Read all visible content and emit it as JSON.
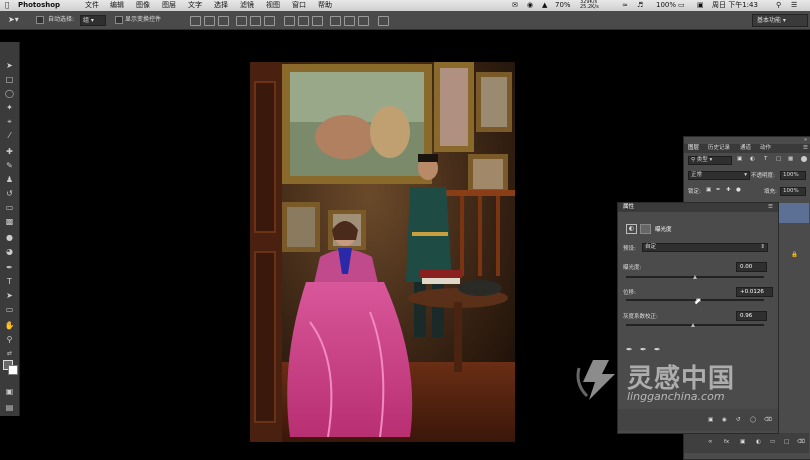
{
  "menubar": {
    "app_name": "Photoshop",
    "items": [
      "文件",
      "编辑",
      "图像",
      "图层",
      "文字",
      "选择",
      "滤镜",
      "视图",
      "窗口",
      "帮助"
    ],
    "battery_pct": "70%",
    "net_up": "329K/s",
    "net_down": "25.2K/s",
    "battery_full": "100%",
    "clock": "周日 下午1:43"
  },
  "options_bar": {
    "auto_select_label": "自动选择:",
    "auto_select_value": "组",
    "show_transform_label": "显示变换控件",
    "workspace": "基本功能"
  },
  "layers_panel": {
    "tabs": [
      "图层",
      "历史记录",
      "通道",
      "动作"
    ],
    "filter_kind": "类型",
    "blend_mode": "正常",
    "opacity_label": "不透明度:",
    "opacity_value": "100%",
    "lock_label": "锁定:",
    "fill_label": "填充:",
    "fill_value": "100%"
  },
  "properties_panel": {
    "title": "属性",
    "adjustment_name": "曝光度",
    "preset_label": "预设:",
    "preset_value": "自定",
    "exposure_label": "曝光度:",
    "exposure_value": "0.00",
    "exposure_level": 0.5,
    "offset_label": "位移:",
    "offset_value": "+0.0126",
    "offset_level": 0.52,
    "gamma_label": "灰度系数校正:",
    "gamma_value": "0.96",
    "gamma_level": 0.49
  },
  "watermark": {
    "brand": "灵感中国",
    "url": "lingganchina.com"
  },
  "colors": {
    "ui_panel": "#4b4b4b",
    "ui_dark": "#3a3a3a",
    "canvas_bg": "#000000",
    "dress_pink": "#d9468e",
    "jacket_teal": "#1f4b45"
  }
}
